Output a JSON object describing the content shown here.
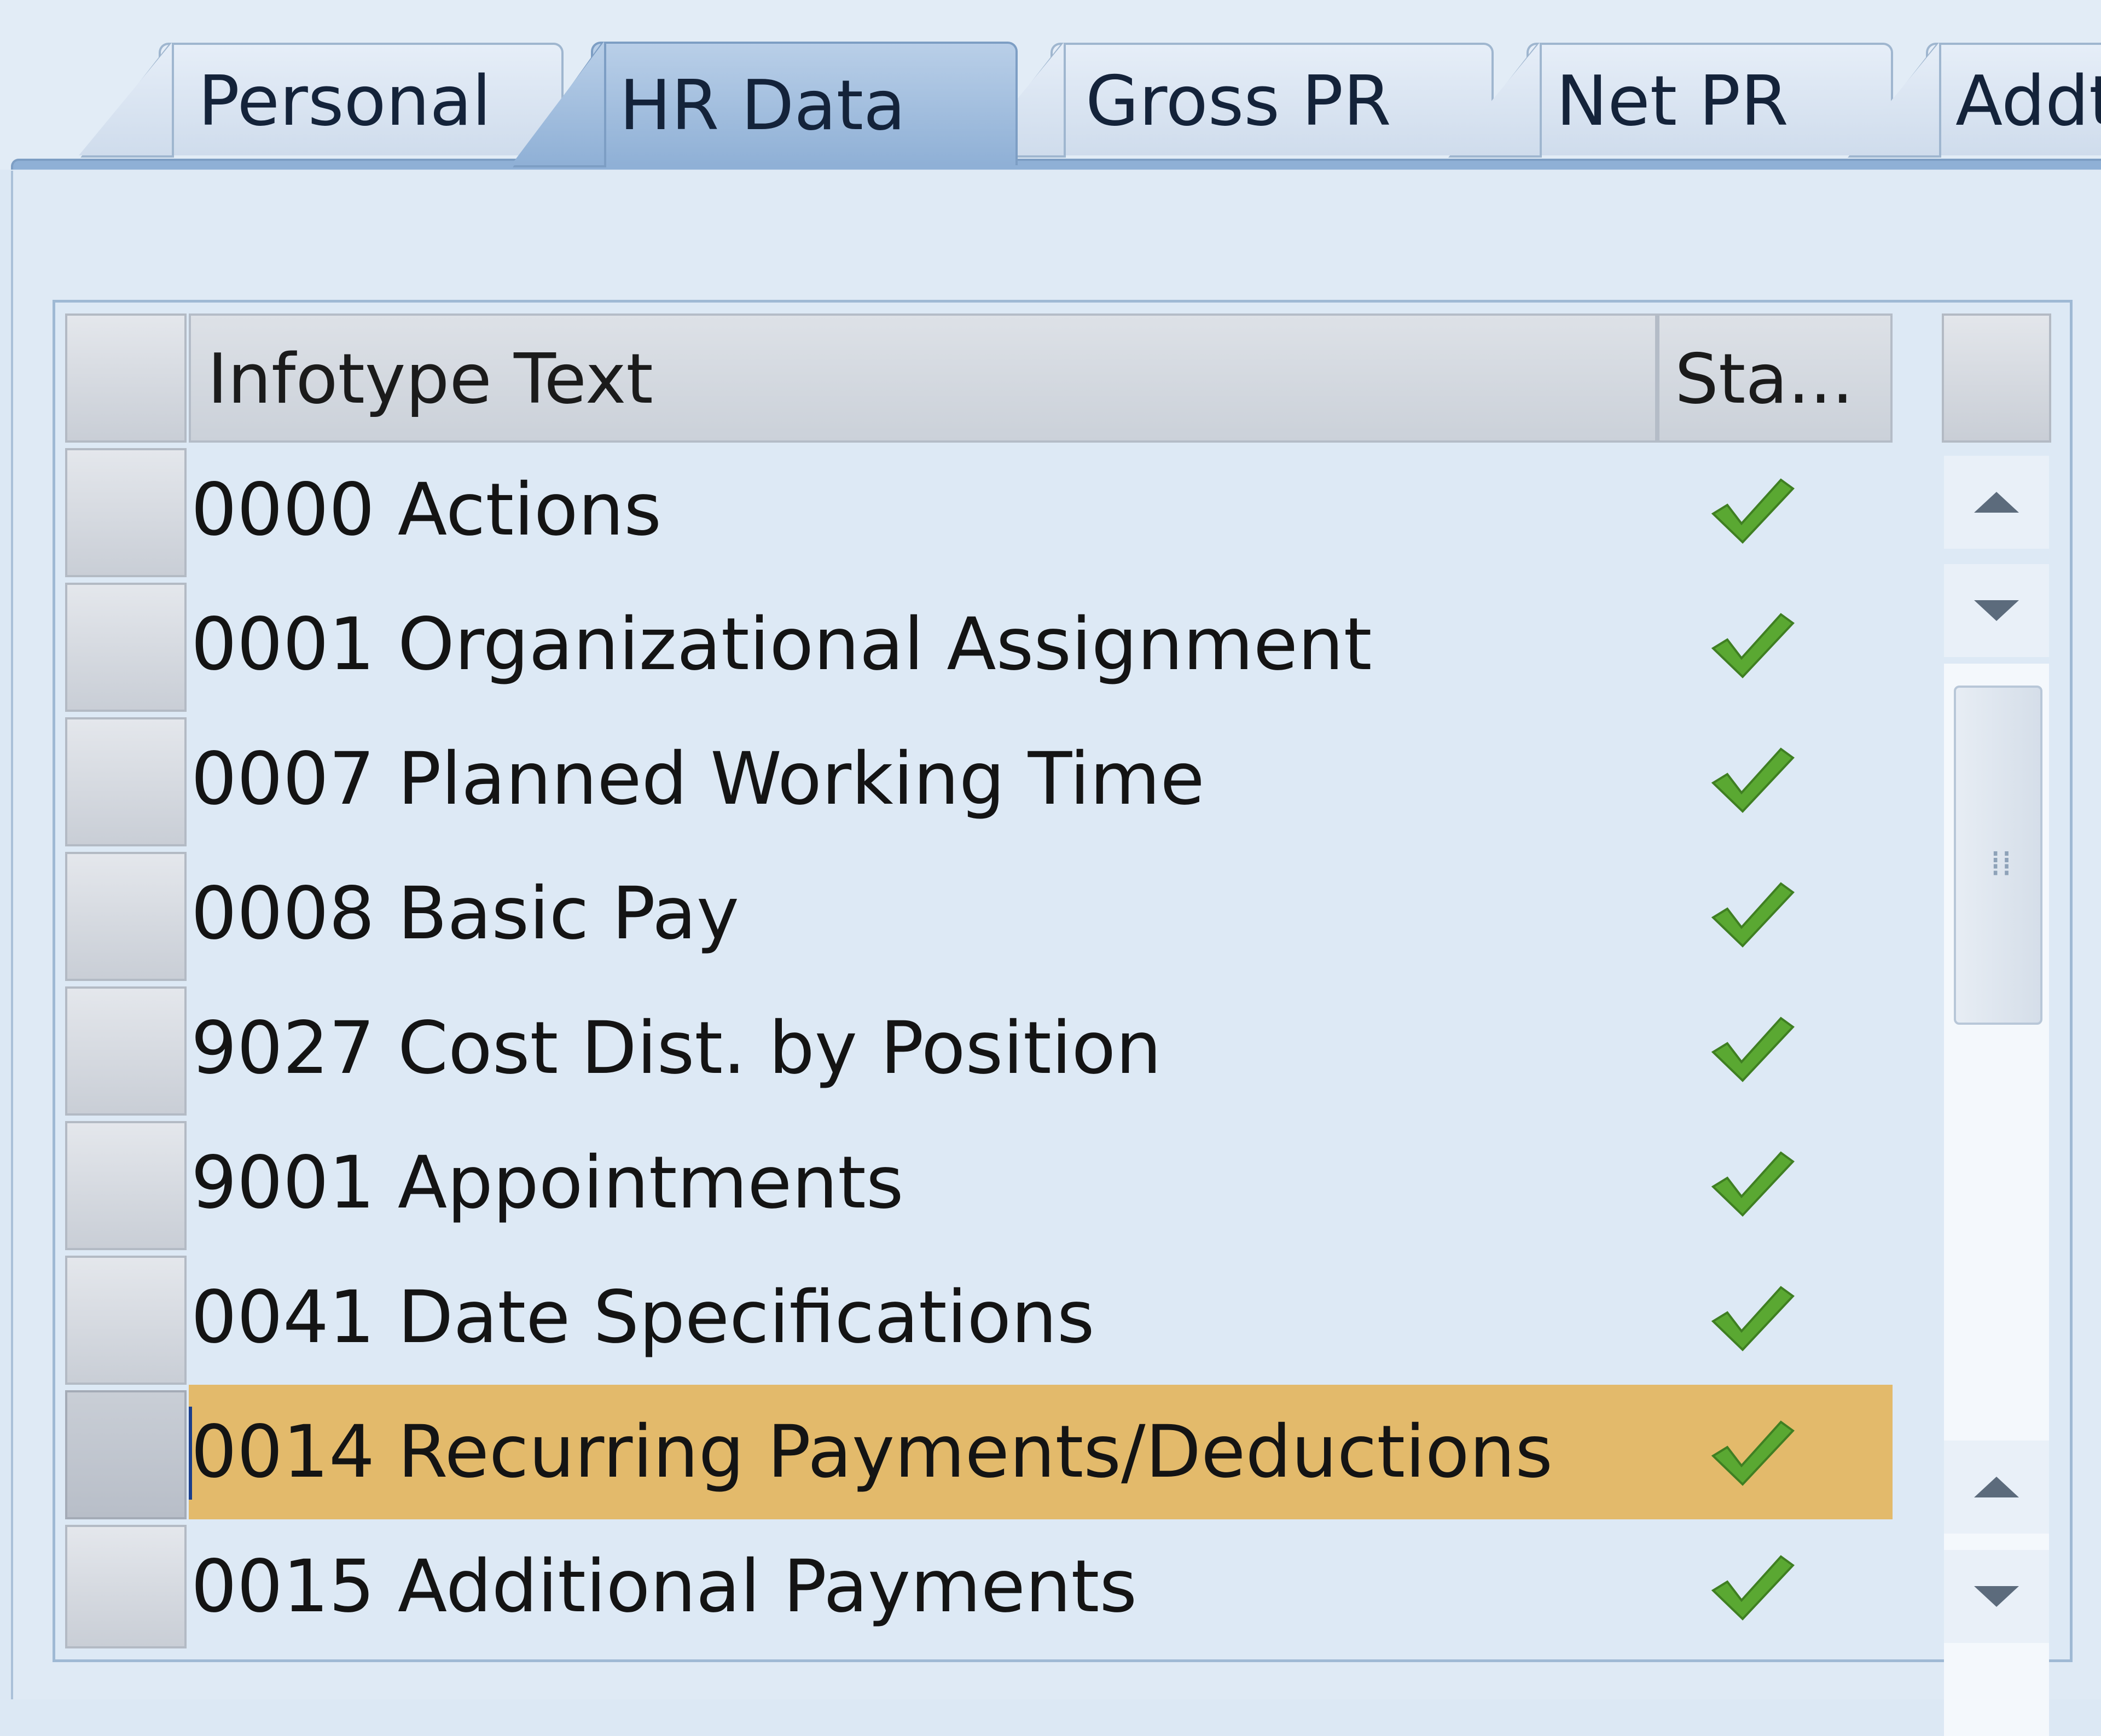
{
  "tabs": [
    {
      "label": "Personal",
      "active": false
    },
    {
      "label": "HR Data",
      "active": true
    },
    {
      "label": "Gross PR",
      "active": false
    },
    {
      "label": "Net PR",
      "active": false
    },
    {
      "label": "Addt",
      "active": false
    }
  ],
  "table": {
    "columns": [
      "Infotype Text",
      "Sta..."
    ],
    "rows": [
      {
        "text": "0000 Actions",
        "status_icon": "check-icon"
      },
      {
        "text": "0001 Organizational Assignment",
        "status_icon": "check-icon"
      },
      {
        "text": "0007 Planned Working Time",
        "status_icon": "check-icon"
      },
      {
        "text": "0008 Basic Pay",
        "status_icon": "check-icon"
      },
      {
        "text": "9027 Cost Dist. by Position",
        "status_icon": "check-icon"
      },
      {
        "text": "9001 Appointments",
        "status_icon": "check-icon"
      },
      {
        "text": "0041 Date Specifications",
        "status_icon": "check-icon"
      },
      {
        "text": "0014 Recurring Payments/Deductions",
        "status_icon": "check-icon",
        "selected": true
      },
      {
        "text": "0015 Additional Payments",
        "status_icon": "check-icon"
      }
    ],
    "selected_row_color": "#e3ba6b",
    "check_color": "#5aa832"
  },
  "scrollbar": {
    "position_fraction": 0.0,
    "visible_fraction": 0.35
  }
}
